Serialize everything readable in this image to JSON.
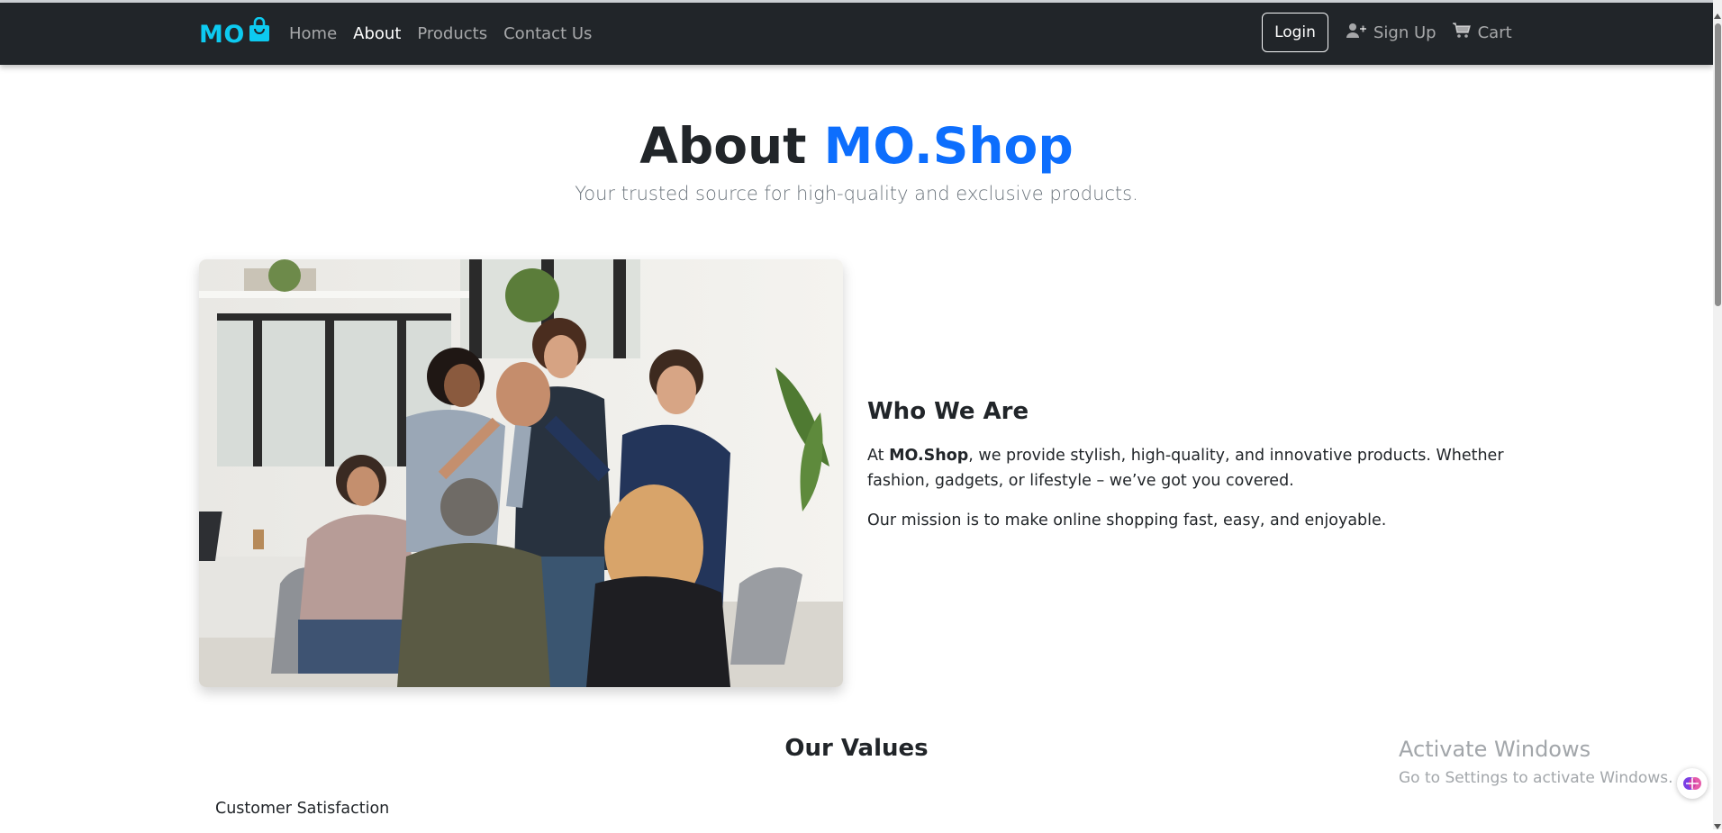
{
  "navbar": {
    "brand": "MO",
    "links": [
      "Home",
      "About",
      "Products",
      "Contact Us"
    ],
    "active_link": "About",
    "login": "Login",
    "signup": "Sign Up",
    "cart": "Cart"
  },
  "hero": {
    "title_prefix": "About",
    "title_brand": "MO.Shop",
    "subtitle": "Your trusted source for high-quality and exclusive products."
  },
  "who": {
    "title": "Who We Are",
    "p1_pre": "At ",
    "p1_bold": "MO.Shop",
    "p1_post": ", we provide stylish, high-quality, and innovative products. Whether fashion, gadgets, or lifestyle – we’ve got you covered.",
    "p2": "Our mission is to make online shopping fast, easy, and enjoyable."
  },
  "values": {
    "title": "Our Values",
    "items": [
      "Customer Satisfaction"
    ]
  },
  "watermark": {
    "line1": "Activate Windows",
    "line2": "Go to Settings to activate Windows."
  },
  "colors": {
    "navbar_bg": "#212529",
    "brand": "#0dcaf0",
    "accent_blue": "#0d6efd"
  },
  "icons": [
    "shopping-bag-icon",
    "add-user-icon",
    "cart-icon",
    "copilot-icon"
  ]
}
